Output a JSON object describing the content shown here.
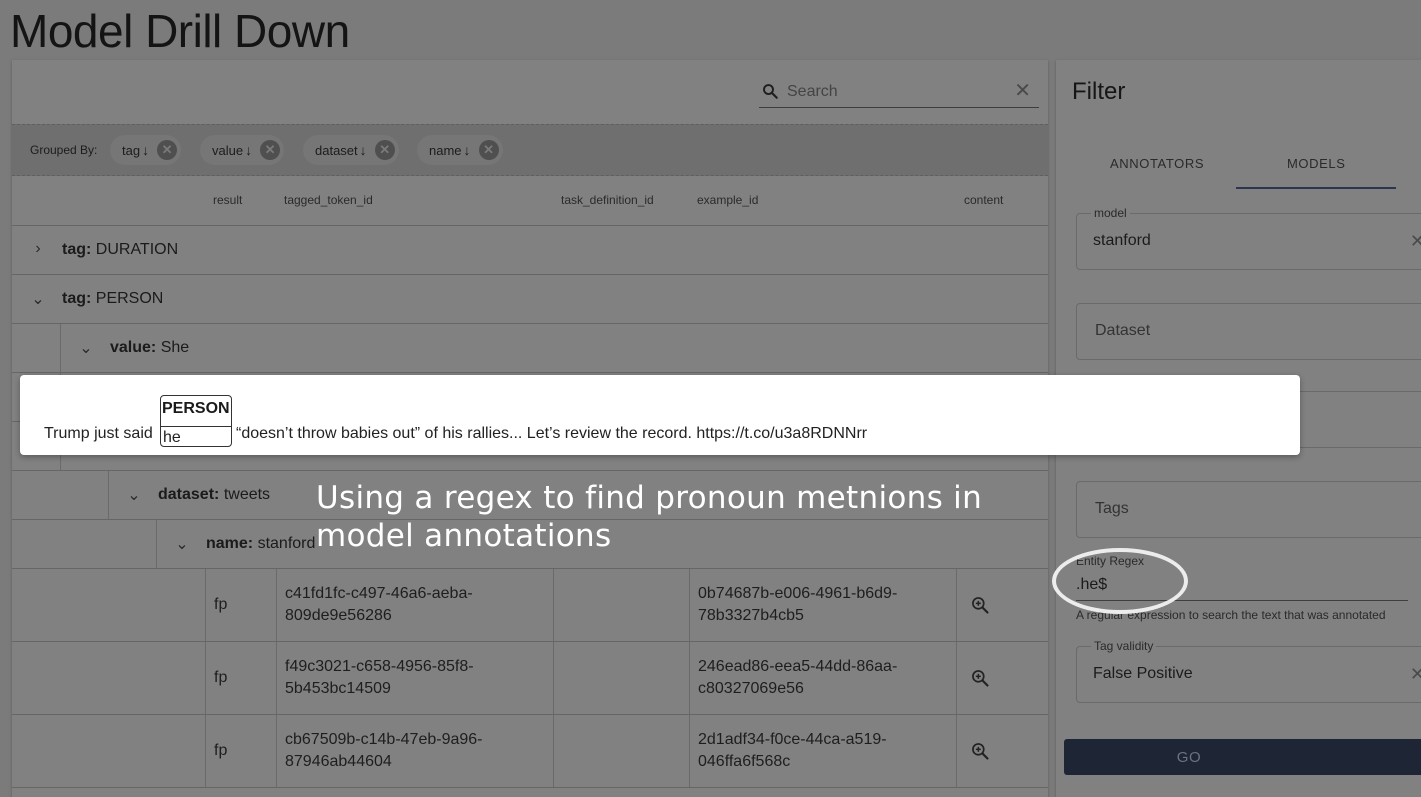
{
  "page": {
    "title": "Model Drill Down"
  },
  "search": {
    "placeholder": "Search",
    "clear": "✕"
  },
  "group_bar": {
    "label": "Grouped By:",
    "chips": [
      {
        "label": "tag",
        "arrow": "↓"
      },
      {
        "label": "value",
        "arrow": "↓"
      },
      {
        "label": "dataset",
        "arrow": "↓"
      },
      {
        "label": "name",
        "arrow": "↓"
      }
    ]
  },
  "columns": [
    "result",
    "tagged_token_id",
    "task_definition_id",
    "example_id",
    "content"
  ],
  "groups": [
    {
      "key": "tag:",
      "value": "DURATION"
    },
    {
      "key": "tag:",
      "value": "PERSON"
    },
    {
      "key": "value:",
      "value": "She"
    },
    {
      "key": "dataset:",
      "value": "tweets"
    },
    {
      "key": "name:",
      "value": "stanford"
    }
  ],
  "rows": [
    {
      "result": "fp",
      "tagged_token_id": [
        "c41fd1fc-c497-46a6-aeba-",
        "809de9e56286"
      ],
      "example_id": [
        "0b74687b-e006-4961-b6d9-",
        "78b3327b4cb5"
      ]
    },
    {
      "result": "fp",
      "tagged_token_id": [
        "f49c3021-c658-4956-85f8-",
        "5b453bc14509"
      ],
      "example_id": [
        "246ead86-eea5-44dd-86aa-",
        "c80327069e56"
      ]
    },
    {
      "result": "fp",
      "tagged_token_id": [
        "cb67509b-c14b-47eb-9a96-",
        "87946ab44604"
      ],
      "example_id": [
        "2d1adf34-f0ce-44ca-a519-",
        "046ffa6f568c"
      ]
    }
  ],
  "popup": {
    "before": "Trump just said",
    "entity_tag": "PERSON",
    "entity_text": "he",
    "after": "“doesn’t throw babies out” of his rallies... Let’s review the record. https://t.co/u3a8RDNNrr"
  },
  "caption": "Using a regex to find pronoun metnions in model annotations",
  "filter": {
    "title": "Filter",
    "tabs": [
      "ANNOTATORS",
      "MODELS"
    ],
    "model_label": "model",
    "model_value": "stanford",
    "dataset_placeholder": "Dataset",
    "tags_placeholder": "Tags",
    "regex_label": "Entity Regex",
    "regex_value": ".he$",
    "regex_help": "A regular expression to search the text that was annotated",
    "validity_label": "Tag validity",
    "validity_value": "False Positive",
    "clear": "✕",
    "go_label": "GO"
  }
}
